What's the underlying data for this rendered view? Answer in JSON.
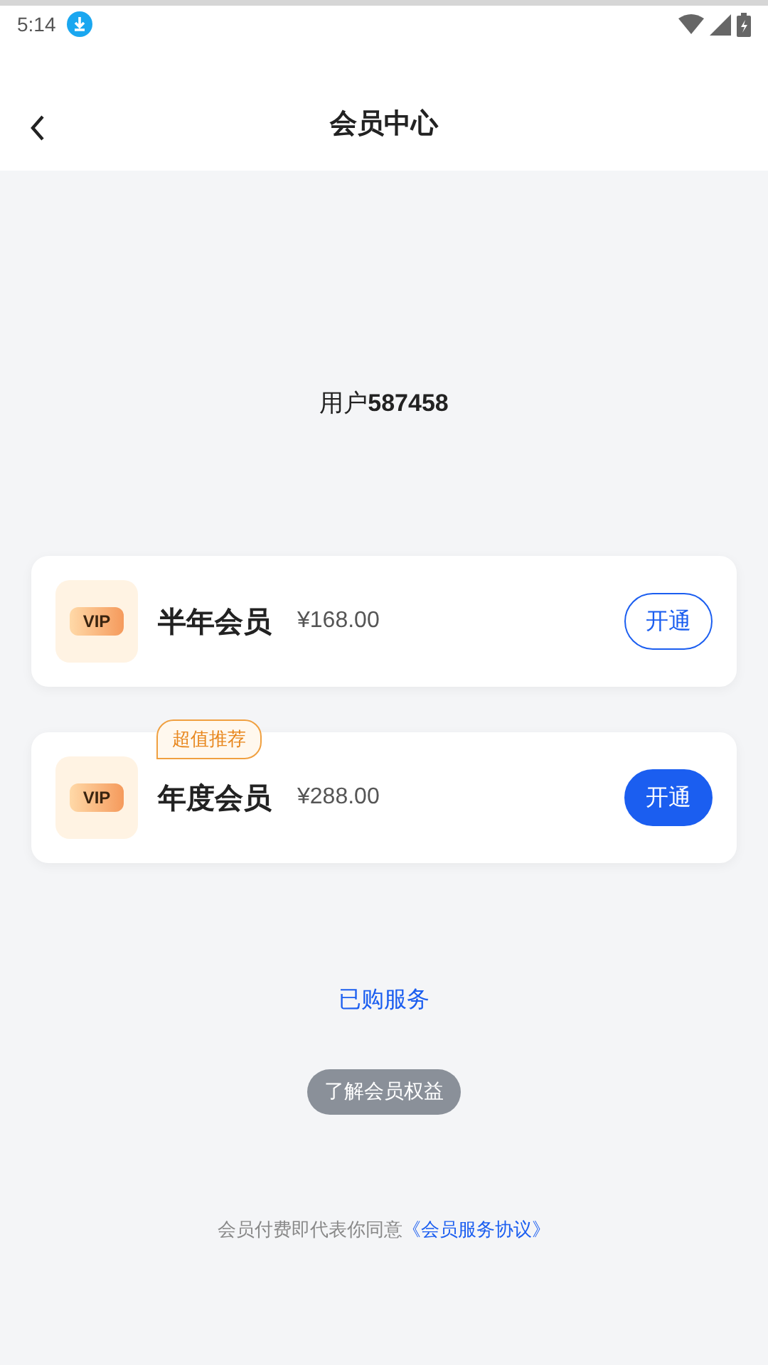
{
  "status_bar": {
    "time": "5:14"
  },
  "header": {
    "title": "会员中心"
  },
  "user": {
    "label": "用户",
    "id": "587458"
  },
  "plans": [
    {
      "badge_text": "VIP",
      "name": "半年会员",
      "price": "¥168.00",
      "button": "开通",
      "featured": false
    },
    {
      "badge_text": "VIP",
      "name": "年度会员",
      "price": "¥288.00",
      "button": "开通",
      "featured": true,
      "tag": "超值推荐"
    }
  ],
  "purchased_link": "已购服务",
  "benefits_button": "了解会员权益",
  "agreement": {
    "text": "会员付费即代表你同意",
    "link": "《会员服务协议》"
  }
}
